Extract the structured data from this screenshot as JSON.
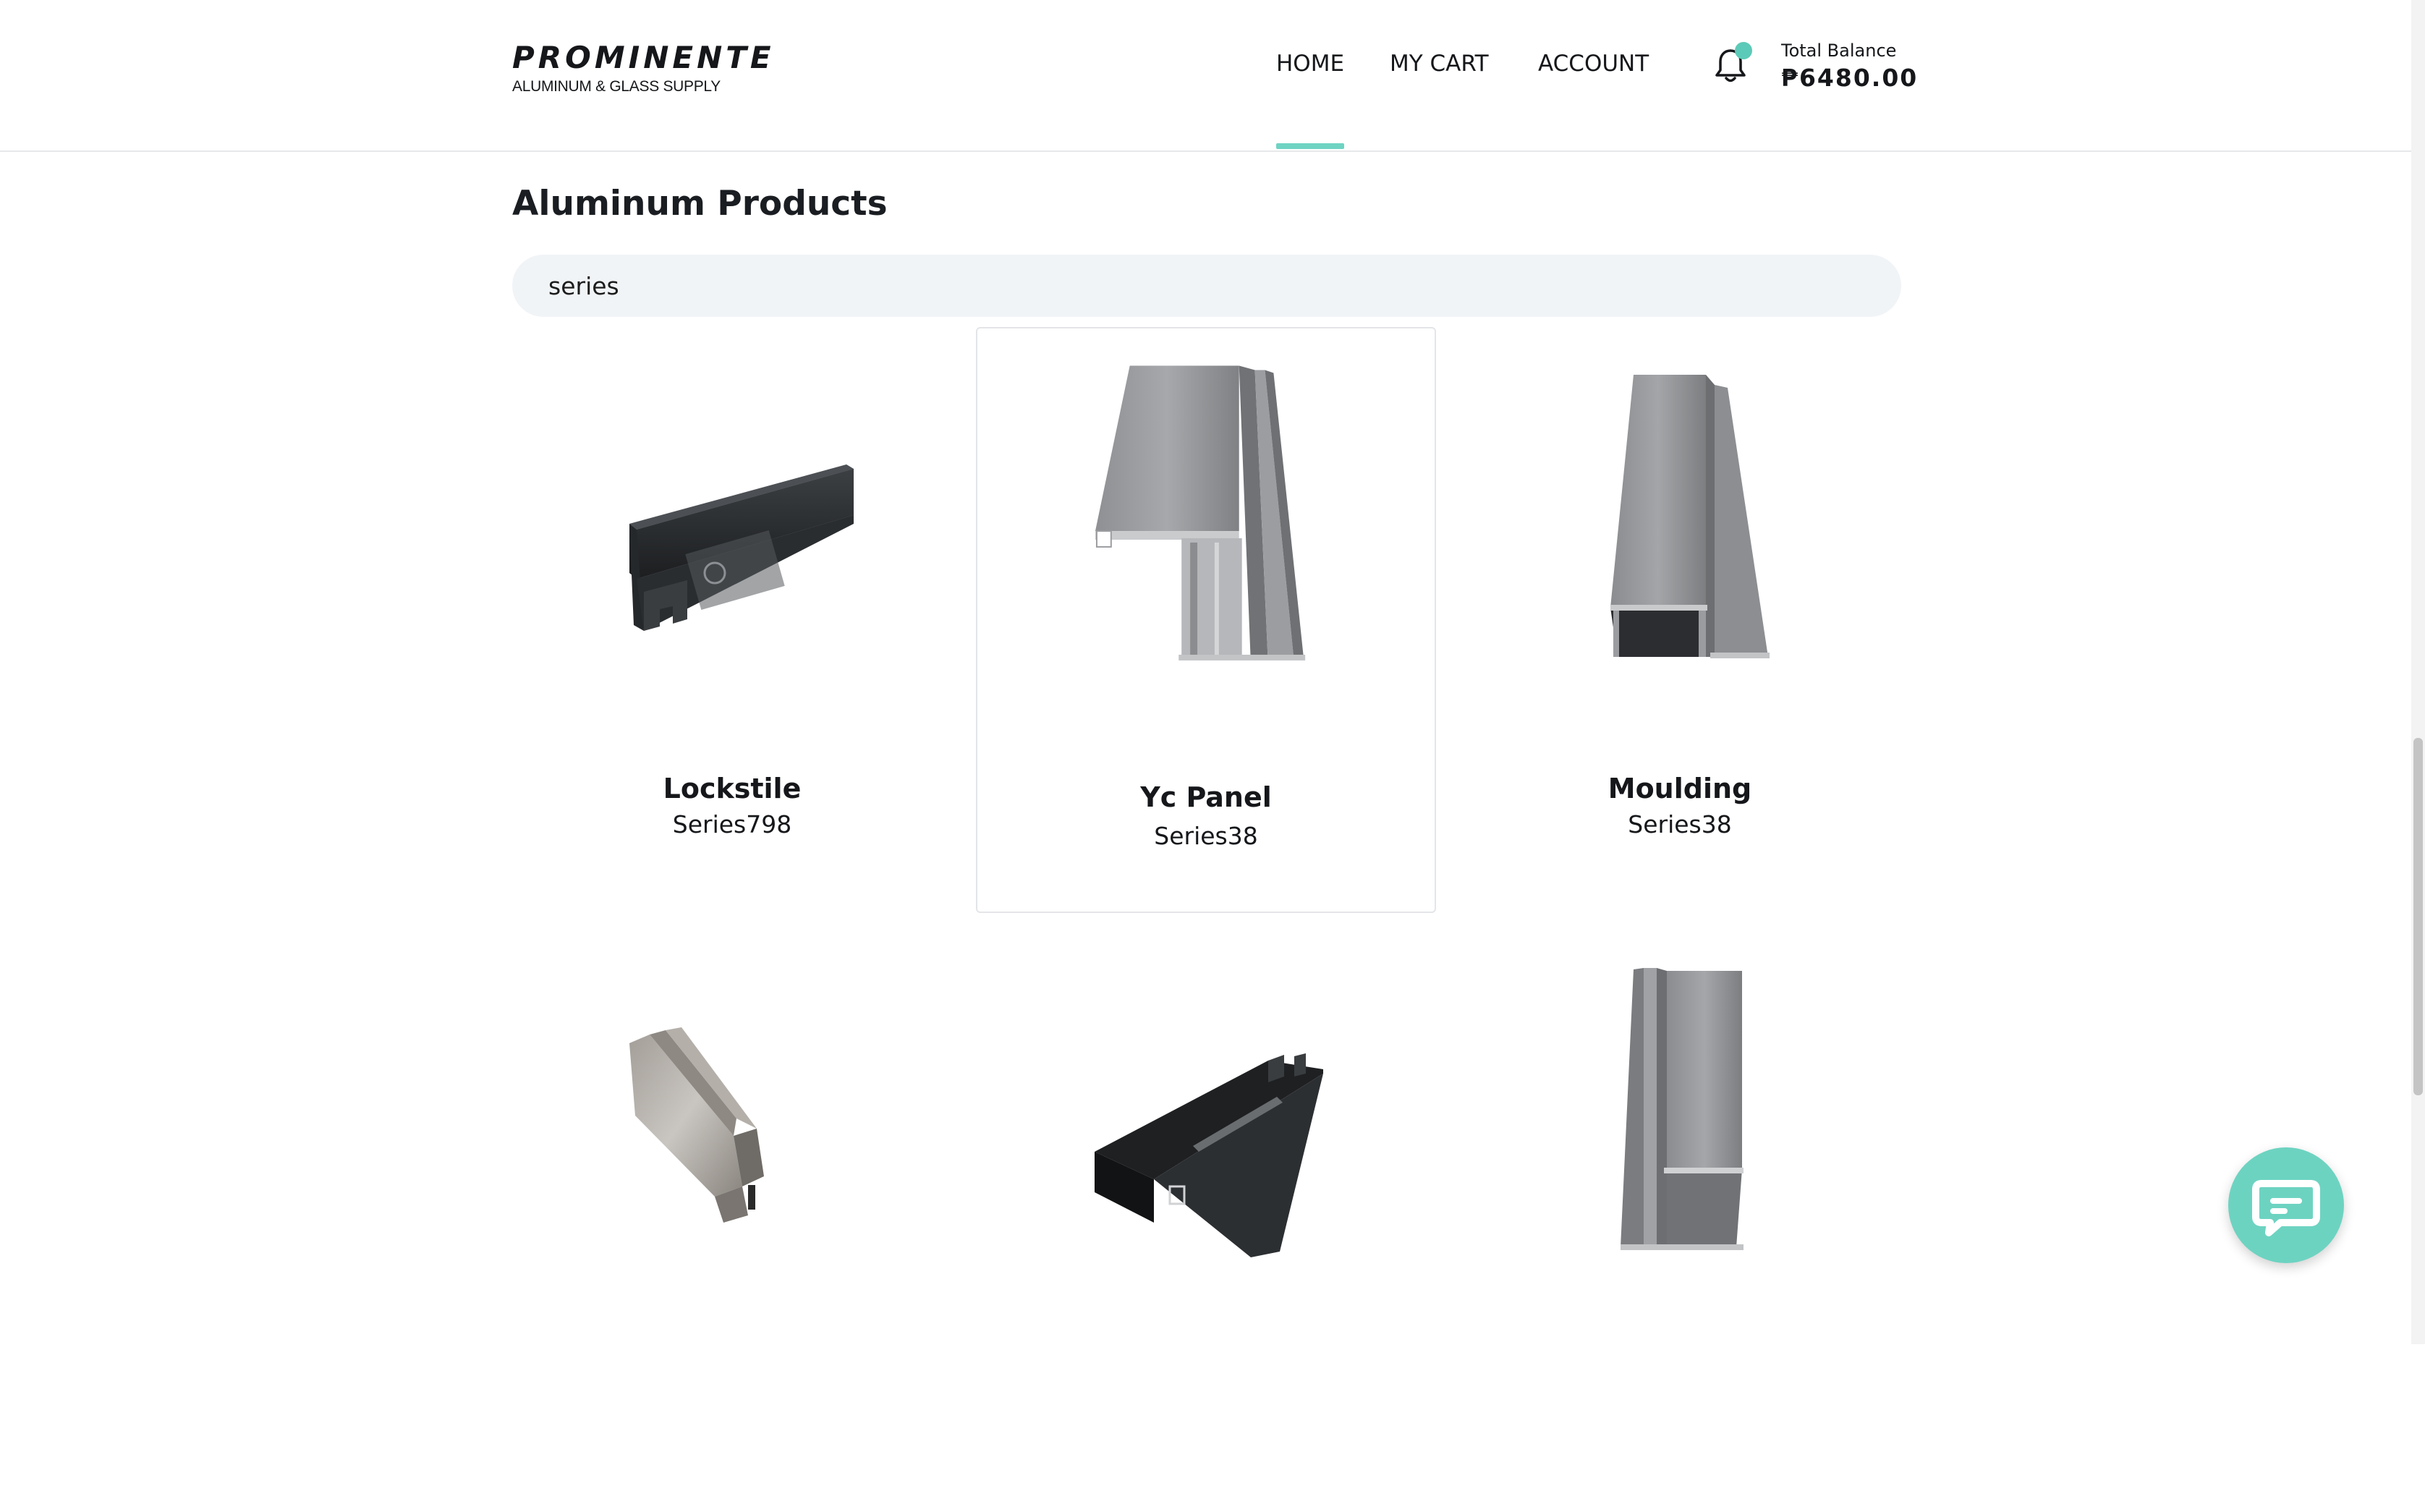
{
  "brand": {
    "name": "PROMINENTE",
    "tagline": "ALUMINUM & GLASS SUPPLY"
  },
  "nav": {
    "items": [
      {
        "label": "HOME",
        "active": true
      },
      {
        "label": "MY CART",
        "active": false
      },
      {
        "label": "ACCOUNT",
        "active": false
      }
    ],
    "notification_icon": "bell-icon"
  },
  "balance": {
    "label": "Total Balance",
    "value": "₱6480.00"
  },
  "main": {
    "title": "Aluminum Products",
    "search": {
      "value": "series",
      "placeholder": ""
    },
    "products": [
      {
        "name": "Lockstile",
        "series": "Series798"
      },
      {
        "name": "Yc Panel",
        "series": "Series38"
      },
      {
        "name": "Moulding",
        "series": "Series38"
      },
      {
        "name": "",
        "series": ""
      },
      {
        "name": "",
        "series": ""
      },
      {
        "name": "",
        "series": ""
      }
    ]
  },
  "colors": {
    "accent": "#6fd3c3",
    "notification_dot": "#5ccab8",
    "search_bg": "#f1f4f7",
    "chat_button": "#6dd3c1"
  },
  "chat": {
    "icon": "chat-bubble-icon"
  }
}
